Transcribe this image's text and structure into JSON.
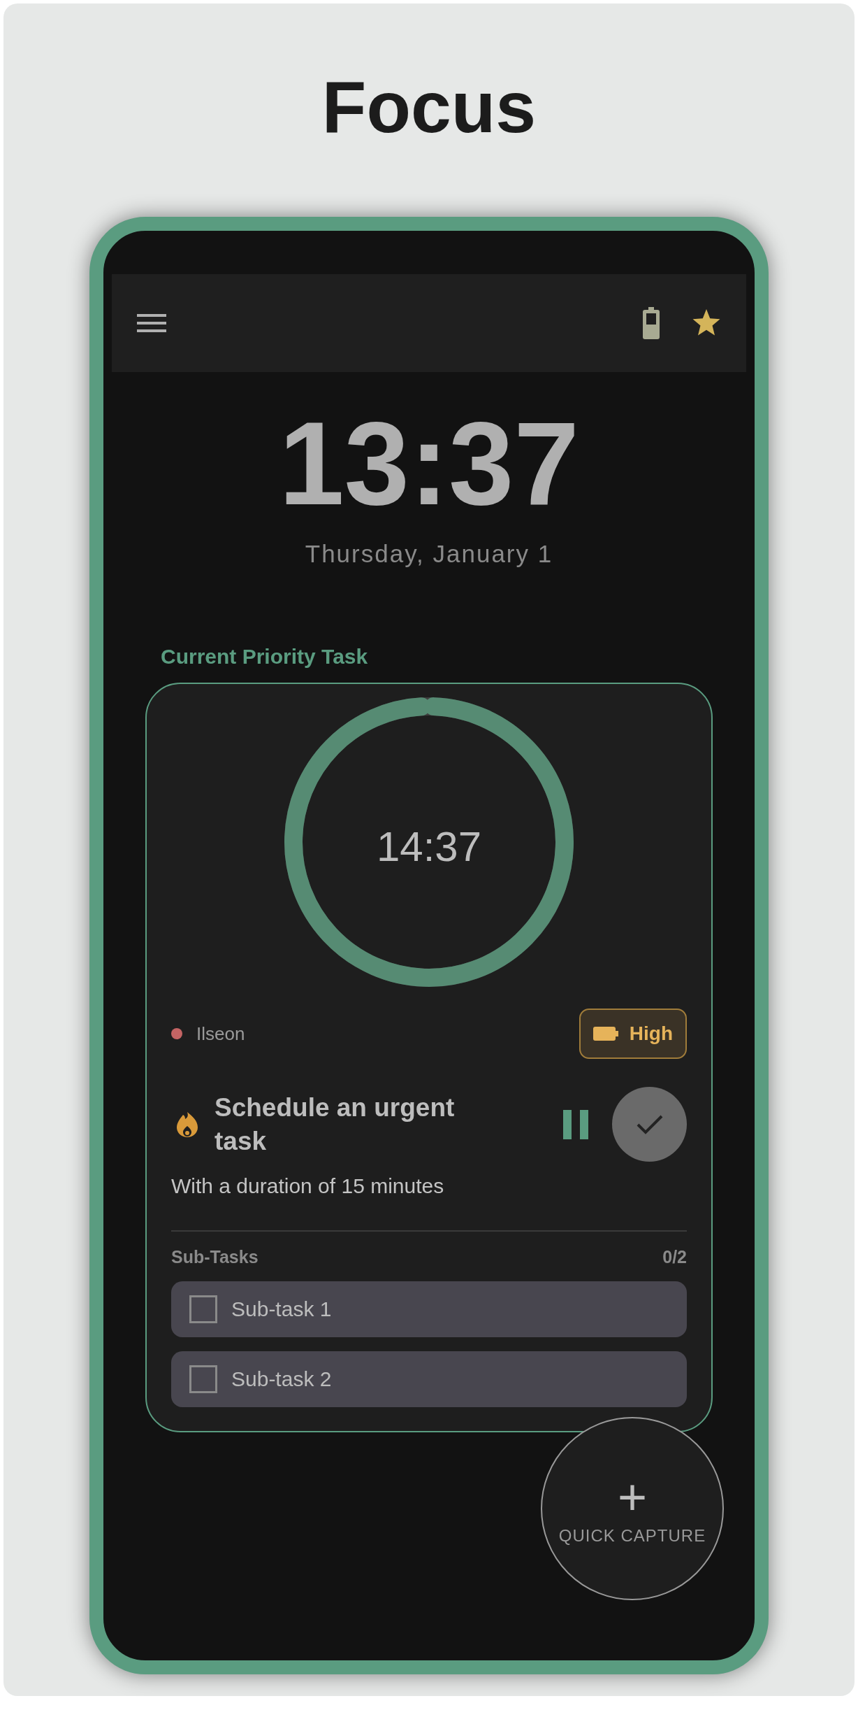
{
  "page_title": "Focus",
  "clock": {
    "time": "13:37",
    "date": "Thursday, January 1"
  },
  "section_title": "Current Priority Task",
  "task": {
    "timer": {
      "remaining": "14:37",
      "level": 0.985
    },
    "project": {
      "name": "Ilseon",
      "color": "#c46464"
    },
    "priority": {
      "label": "High"
    },
    "title": "Schedule an urgent task",
    "subtitle": "With a duration of 15 minutes",
    "subtasks_label": "Sub-Tasks",
    "subtasks_count": "0/2",
    "subtasks": [
      {
        "label": "Sub-task 1",
        "checked": false
      },
      {
        "label": "Sub-task 2",
        "checked": false
      }
    ]
  },
  "fab": {
    "icon": "+",
    "label": "QUICK CAPTURE"
  }
}
